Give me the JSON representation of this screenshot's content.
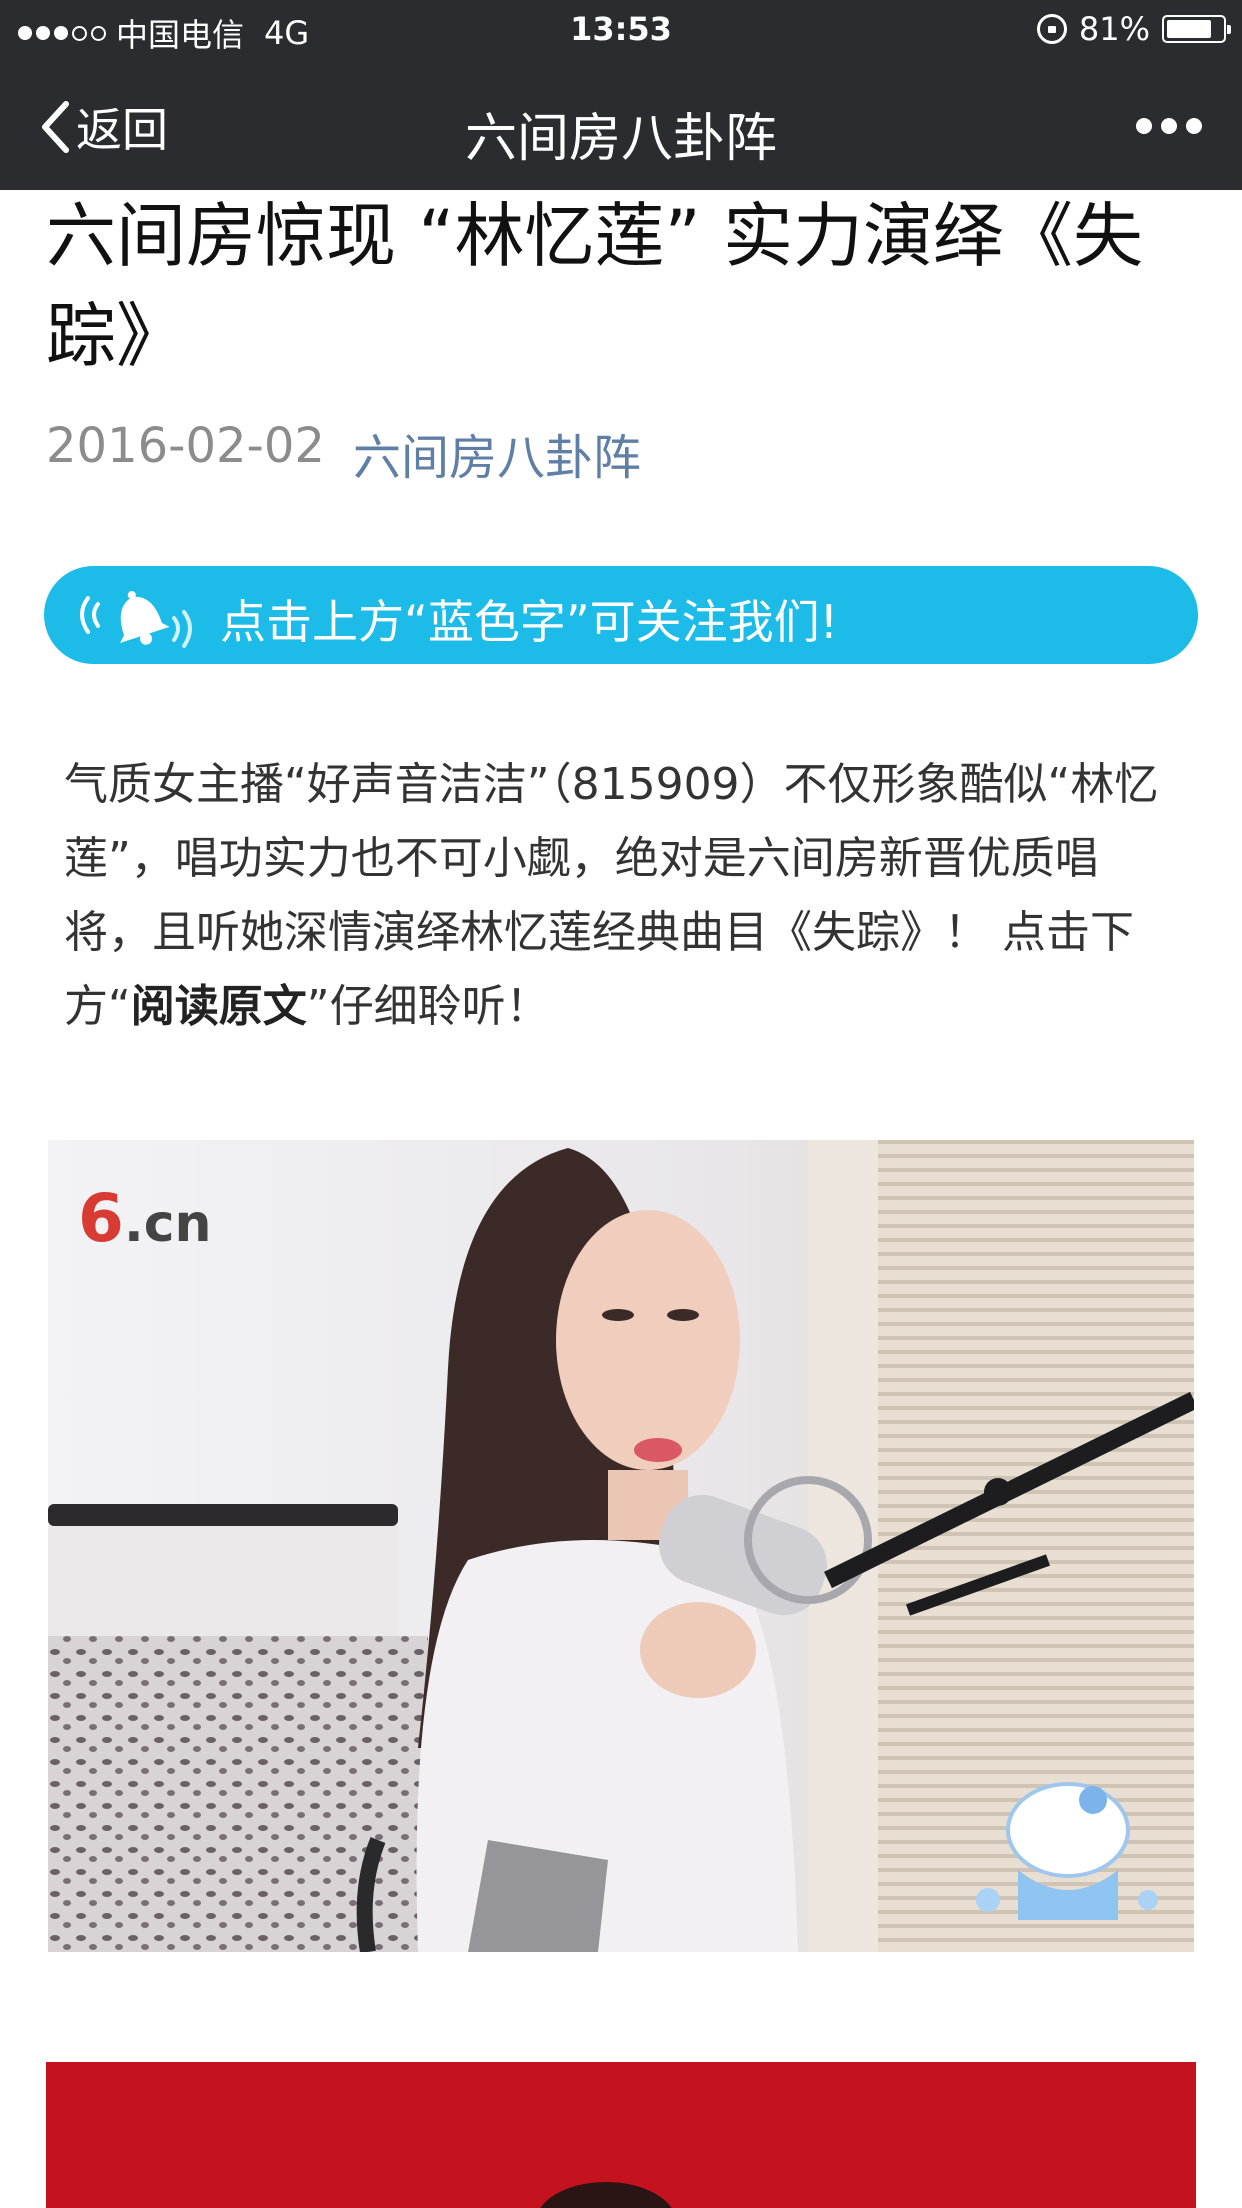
{
  "status_bar": {
    "carrier": "中国电信",
    "network": "4G",
    "time": "13:53",
    "battery": "81%",
    "battery_level": 0.81
  },
  "nav": {
    "back_label": "返回",
    "title": "六间房八卦阵"
  },
  "article": {
    "title": "六间房惊现 “林忆莲” 实力演绎《失踪》",
    "date": "2016-02-02",
    "account": "六间房八卦阵",
    "follow_banner": "点击上方“蓝色字”可关注我们!",
    "body_before": "气质女主播“好声音洁洁”（815909）不仅形象酷似“林忆莲”，唱功实力也不可小觑，绝对是六间房新晋优质唱将，且听她深情演绎林忆莲经典曲目《失踪》！ 点击下方“",
    "body_bold": "阅读原文",
    "body_after": "”仔细聆听！",
    "image_watermark": ".cn",
    "image_watermark_digit": "6"
  },
  "colors": {
    "bar_bg": "#2b2c2f",
    "banner": "#1dbbe8",
    "account_link": "#607fa6",
    "red_block": "#c4121f"
  }
}
